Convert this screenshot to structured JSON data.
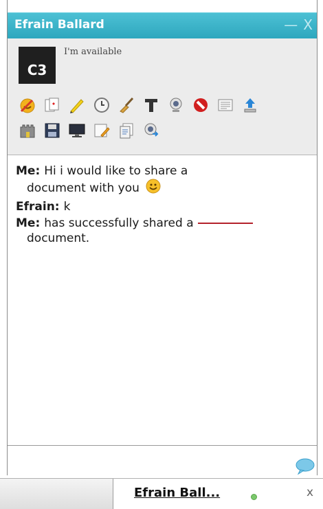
{
  "window": {
    "title": "Efrain Ballard",
    "minimize_label": "—",
    "close_label": "X"
  },
  "profile": {
    "avatar_text": "C3",
    "status": "I'm available"
  },
  "toolbar": {
    "row1": [
      "emoticons-icon",
      "cards-icon",
      "pencil-icon",
      "clock-icon",
      "broom-icon",
      "text-format-icon",
      "webcam-icon",
      "block-icon",
      "notepad-icon",
      "upload-icon"
    ],
    "row2": [
      "castle-icon",
      "save-icon",
      "monitor-icon",
      "edit-note-icon",
      "documents-icon",
      "webcam-share-icon"
    ]
  },
  "messages": [
    {
      "sender": "Me:",
      "text": "Hi i would like to share a",
      "cont": "document with you",
      "emoji": "smiley-icon"
    },
    {
      "sender": "Efrain:",
      "text": "k",
      "cont": ""
    },
    {
      "sender": "Me:",
      "text": "has successfully shared a",
      "cont": "document."
    }
  ],
  "taskbar": {
    "chat_tab_label": "Efrain Ball...",
    "close_label": "x"
  },
  "colors": {
    "titlebar": "#34aec4",
    "link_red": "#b3212a",
    "online": "#7bc86c"
  }
}
